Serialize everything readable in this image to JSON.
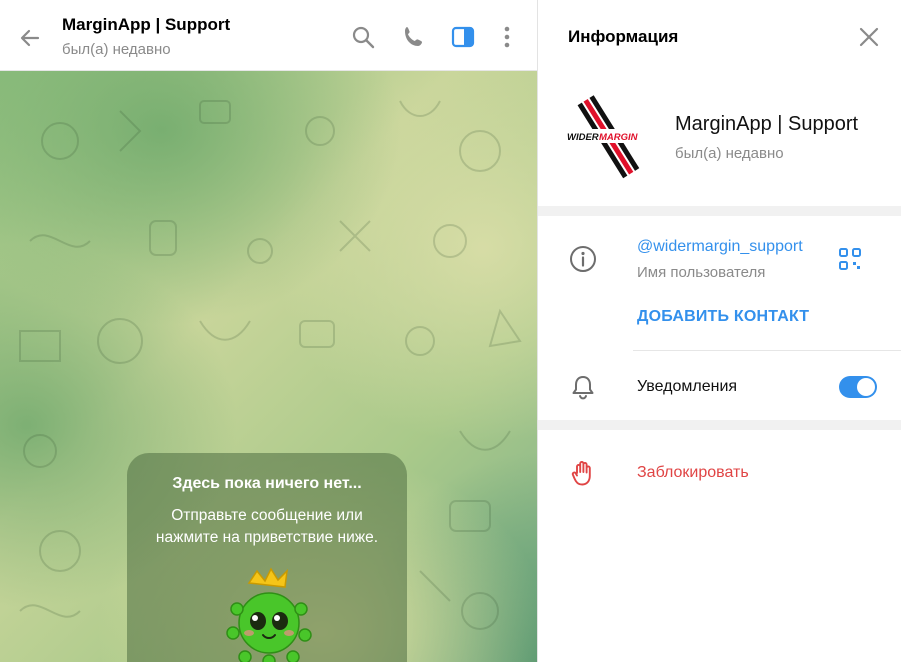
{
  "chat": {
    "title": "MarginApp | Support",
    "status": "был(а) недавно",
    "empty_title": "Здесь пока ничего нет...",
    "empty_text": "Отправьте сообщение или нажмите на приветствие ниже."
  },
  "header_icons": [
    "back-arrow-icon",
    "search-icon",
    "phone-icon",
    "sidebar-panel-icon",
    "more-vertical-icon"
  ],
  "info": {
    "title": "Информация",
    "name": "MarginApp | Support",
    "status": "был(а) недавно",
    "username": "@widermargin_support",
    "username_label": "Имя пользователя",
    "add_contact": "ДОБАВИТЬ КОНТАКТ",
    "notifications_label": "Уведомления",
    "notifications_enabled": true,
    "block_label": "Заблокировать"
  },
  "colors": {
    "accent": "#3390ec",
    "danger": "#e04545",
    "secondary_text": "#8a8a8a"
  }
}
